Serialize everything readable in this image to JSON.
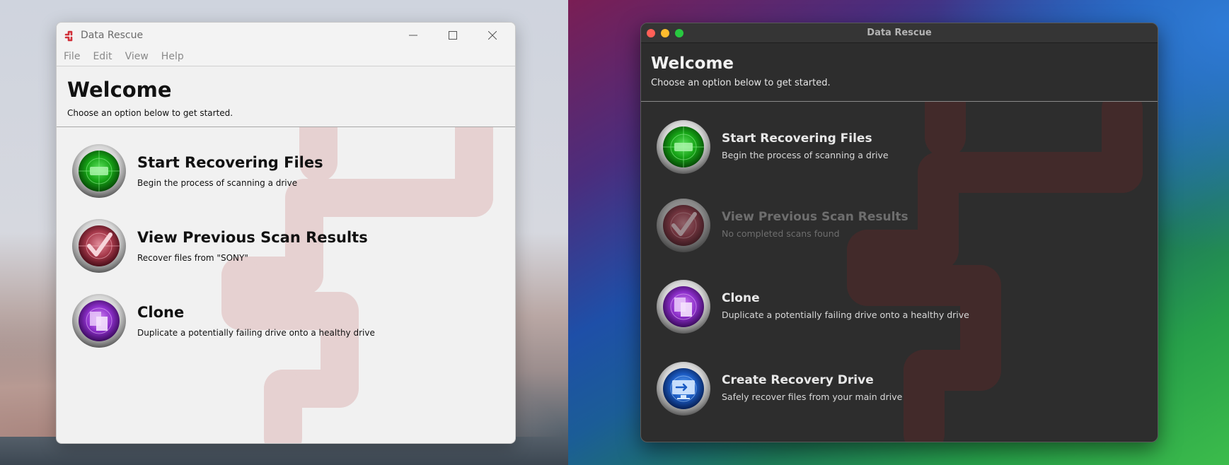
{
  "colors": {
    "accent_red": "#d1313a",
    "recover_green": "#2fbf2f",
    "scan_red": "#b83a4a",
    "clone_purple": "#9b3fd6",
    "recovery_blue": "#1e64c8"
  },
  "windows_app": {
    "title": "Data Rescue",
    "logo_icon": "data-rescue-logo-icon",
    "menu": [
      "File",
      "Edit",
      "View",
      "Help"
    ],
    "header": {
      "title": "Welcome",
      "subtitle": "Choose an option below to get started."
    },
    "options": [
      {
        "icon": "radar-green-icon",
        "title": "Start Recovering Files",
        "subtitle": "Begin the process of scanning a drive"
      },
      {
        "icon": "radar-checkmark-icon",
        "title": "View Previous Scan Results",
        "subtitle": "Recover files from \"SONY\""
      },
      {
        "icon": "radar-clone-icon",
        "title": "Clone",
        "subtitle": "Duplicate a potentially failing drive onto a healthy drive"
      }
    ]
  },
  "mac_app": {
    "title": "Data Rescue",
    "header": {
      "title": "Welcome",
      "subtitle": "Choose an option below to get started."
    },
    "options": [
      {
        "icon": "radar-green-icon",
        "title": "Start Recovering Files",
        "subtitle": "Begin the process of scanning a drive",
        "enabled": true
      },
      {
        "icon": "radar-checkmark-icon",
        "title": "View Previous Scan Results",
        "subtitle": "No completed scans found",
        "enabled": false
      },
      {
        "icon": "radar-clone-icon",
        "title": "Clone",
        "subtitle": "Duplicate a potentially failing drive onto a healthy drive",
        "enabled": true
      },
      {
        "icon": "radar-monitor-icon",
        "title": "Create Recovery Drive",
        "subtitle": "Safely recover files from your main drive",
        "enabled": true
      }
    ]
  }
}
